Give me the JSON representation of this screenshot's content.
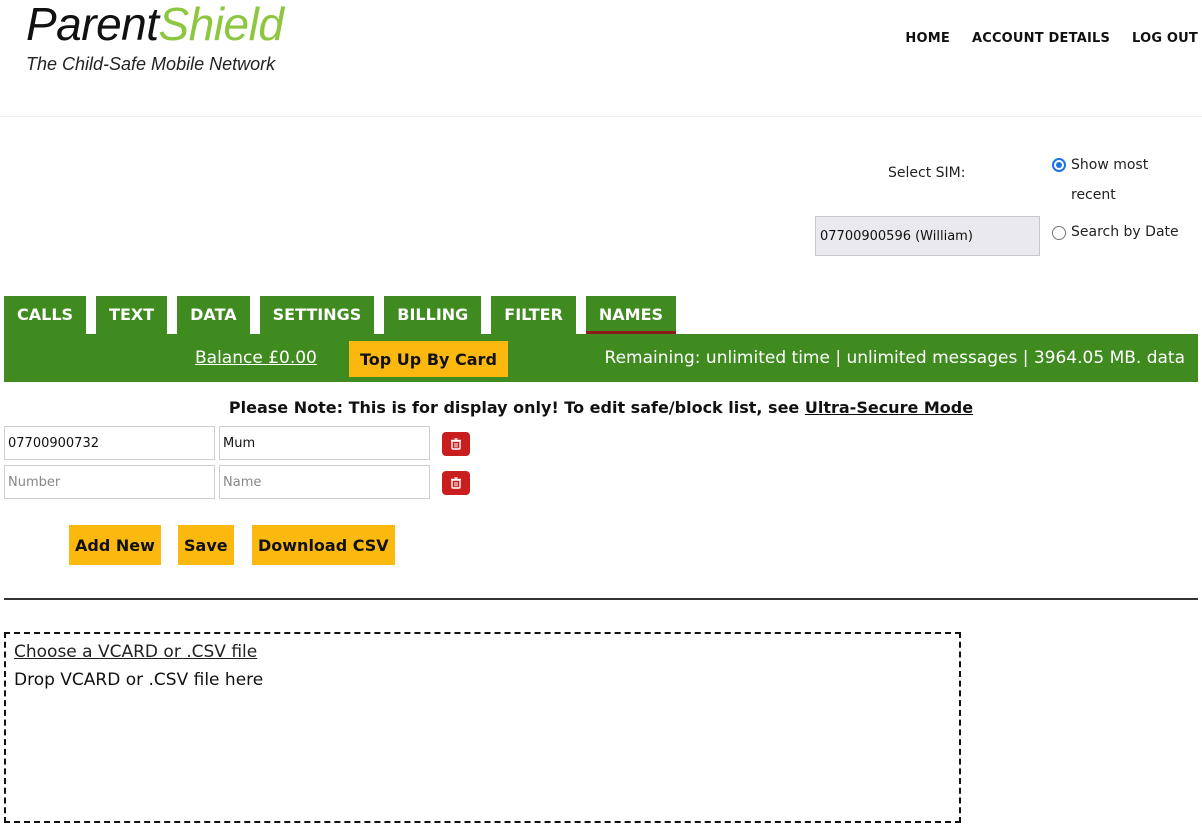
{
  "logo": {
    "title_part1": "Parent",
    "title_part2": "Shield",
    "subtitle": "The Child-Safe Mobile Network"
  },
  "nav": {
    "items": [
      "HOME",
      "ACCOUNT DETAILS",
      "LOG OUT"
    ]
  },
  "sim": {
    "label": "Select SIM:",
    "selected": "07700900596  (William)",
    "radio_recent": "Show most recent",
    "radio_date": "Search by Date"
  },
  "tabs": [
    "CALLS",
    "TEXT",
    "DATA",
    "SETTINGS",
    "BILLING",
    "FILTER",
    "NAMES"
  ],
  "status": {
    "balance": "Balance  £0.00",
    "topup": "Top Up By Card",
    "remaining": "Remaining: unlimited time | unlimited messages | 3964.05 MB. data"
  },
  "note": {
    "text": "Please Note: This is for display only! To edit safe/block list, see ",
    "link": "Ultra-Secure Mode"
  },
  "entries": [
    {
      "number": "07700900732",
      "name": "Mum"
    }
  ],
  "new_entry": {
    "number_placeholder": "Number",
    "name_placeholder": "Name"
  },
  "buttons": {
    "add_new": "Add New",
    "save": "Save",
    "download_csv": "Download CSV"
  },
  "dropzone": {
    "choose": "Choose a VCARD or .CSV file",
    "drop": "Drop VCARD or .CSV file here"
  },
  "colors": {
    "brand_green": "#3f8b1f",
    "logo_green": "#8dc63f",
    "accent_yellow": "#fbb80f",
    "delete_red": "#c81e1e",
    "radio_blue": "#1a73e8"
  }
}
